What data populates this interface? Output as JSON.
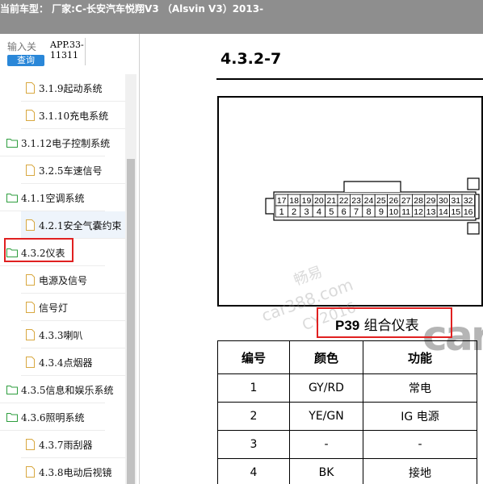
{
  "window": {
    "title": "当前车型： 厂家:C-长安汽车悦翔V3 （Alsvin V3）2013-"
  },
  "sidebar": {
    "search_placeholder": "输入关",
    "search_button": "查询",
    "doc_code": "APP.33-11311",
    "items": [
      {
        "label": "3.1.9起动系统",
        "type": "doc"
      },
      {
        "label": "3.1.10充电系统",
        "type": "doc"
      },
      {
        "label": "3.1.12电子控制系统",
        "type": "folder"
      },
      {
        "label": "3.2.5车速信号",
        "type": "doc"
      },
      {
        "label": "4.1.1空调系统",
        "type": "folder"
      },
      {
        "label": "4.2.1安全气囊约束",
        "type": "doc"
      },
      {
        "label": "4.3.2仪表",
        "type": "folder"
      },
      {
        "label": "电源及信号",
        "type": "doc"
      },
      {
        "label": "信号灯",
        "type": "doc"
      },
      {
        "label": "4.3.3喇叭",
        "type": "doc"
      },
      {
        "label": "4.3.4点烟器",
        "type": "doc"
      },
      {
        "label": "4.3.5信息和娱乐系统",
        "type": "folder"
      },
      {
        "label": "4.3.6照明系统",
        "type": "folder"
      },
      {
        "label": "4.3.7雨刮器",
        "type": "doc"
      },
      {
        "label": "4.3.8电动后视镜",
        "type": "doc"
      }
    ]
  },
  "document": {
    "section_title": "4.3.2-7",
    "connector": {
      "top_pins": [
        "17",
        "18",
        "19",
        "20",
        "21",
        "22",
        "23",
        "24",
        "25",
        "26",
        "27",
        "28",
        "29",
        "30",
        "31",
        "32"
      ],
      "bottom_pins": [
        "1",
        "2",
        "3",
        "4",
        "5",
        "6",
        "7",
        "8",
        "9",
        "10",
        "11",
        "12",
        "13",
        "14",
        "15",
        "16"
      ]
    },
    "connector_code": "P39",
    "connector_name": "组合仪表",
    "watermark_lines": [
      "畅易",
      "car388.com",
      "CY2016"
    ],
    "table": {
      "headers": [
        "编号",
        "颜色",
        "功能"
      ],
      "rows": [
        [
          "1",
          "GY/RD",
          "常电"
        ],
        [
          "2",
          "YE/GN",
          "IG 电源"
        ],
        [
          "3",
          "-",
          "-"
        ],
        [
          "4",
          "BK",
          "接地"
        ]
      ]
    }
  },
  "colors": {
    "titlebar_bg": "#8e8e8e",
    "search_button_bg": "#2a87d8",
    "highlight_red": "#e02020"
  }
}
